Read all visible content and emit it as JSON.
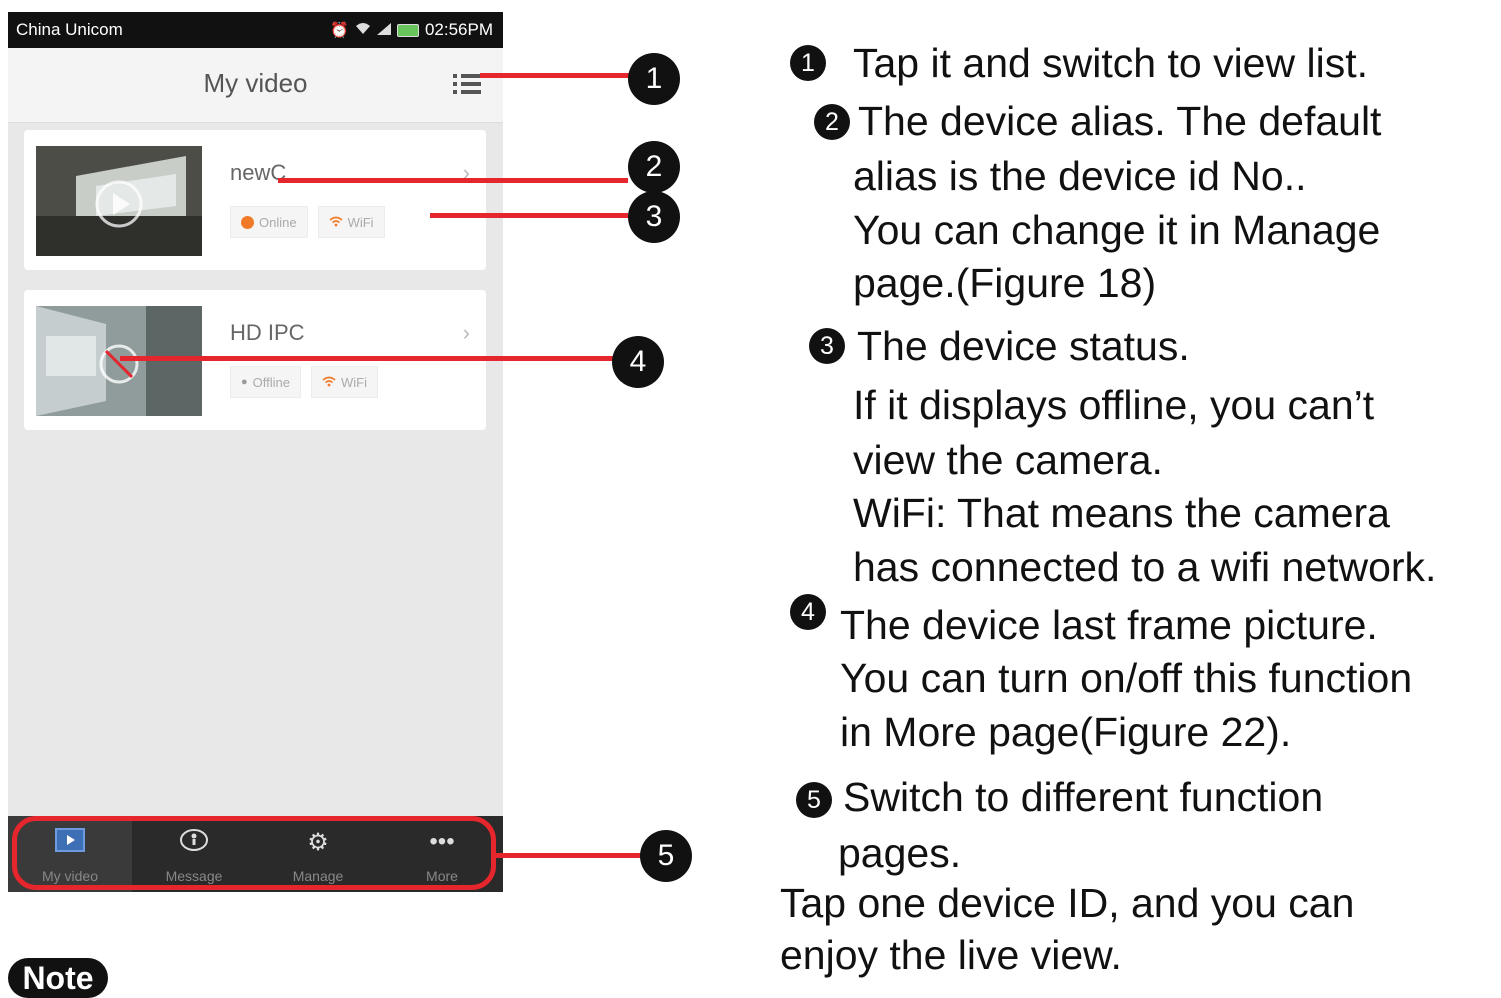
{
  "phone": {
    "statusbar": {
      "carrier": "China Unicom",
      "time": "02:56PM"
    },
    "header": {
      "title": "My video",
      "list_icon": "list-view-icon"
    },
    "devices": [
      {
        "name": "newC",
        "status": "Online",
        "network": "WiFi"
      },
      {
        "name": "HD IPC",
        "status": "Offline",
        "network": "WiFi"
      }
    ],
    "tabs": [
      {
        "label": "My video",
        "icon": "video-icon"
      },
      {
        "label": "Message",
        "icon": "message-icon"
      },
      {
        "label": "Manage",
        "icon": "gear-icon"
      },
      {
        "label": "More",
        "icon": "more-icon"
      }
    ]
  },
  "callouts": [
    "1",
    "2",
    "3",
    "4",
    "5"
  ],
  "instructions": {
    "item1": "Tap it and switch to view list.",
    "item2": [
      "The device alias. The default",
      "alias is the device id No..",
      "You can change it in Manage",
      "page.(Figure 18)"
    ],
    "item3": [
      "The device status.",
      "If it displays offline, you can’t",
      "view the camera.",
      "WiFi: That means the camera",
      "has connected to a wifi network."
    ],
    "item4": [
      "The device last frame picture.",
      "You can turn on/off this function",
      "in More page(Figure 22)."
    ],
    "item5": [
      "Switch to different function",
      "pages."
    ],
    "footer": [
      "Tap one device ID, and you can",
      "enjoy the live view."
    ]
  },
  "note_label": "Note",
  "colors": {
    "annotation_red": "#e5262c",
    "accent_orange": "#f07a28"
  }
}
